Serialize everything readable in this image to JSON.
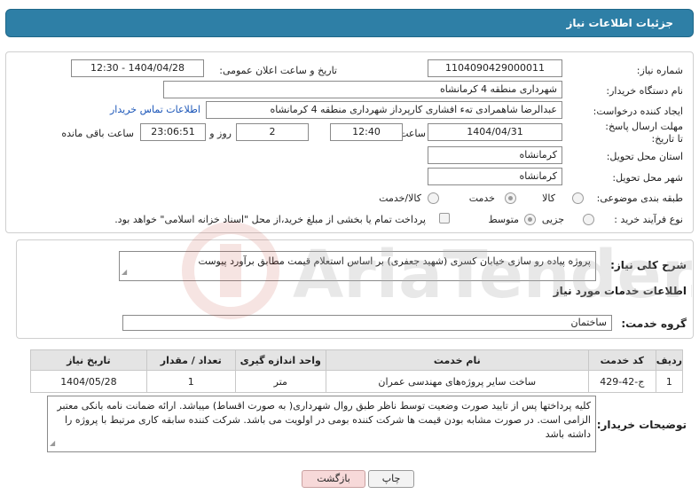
{
  "header": {
    "title": "جزئیات اطلاعات نیاز"
  },
  "form": {
    "need_number": {
      "label": "شماره نیاز:",
      "value": "1104090429000011"
    },
    "announce_datetime": {
      "label": "تاریخ و ساعت اعلان عمومی:",
      "value": "1404/04/28 - 12:30"
    },
    "buyer_org": {
      "label": "نام دستگاه خریدار:",
      "value": "شهرداری منطقه 4 کرمانشاه"
    },
    "creator": {
      "label": "ایجاد کننده درخواست:",
      "value": "عبدالرضا شاهمرادی تهء افشاری کارپرداز شهرداری منطقه 4 کرمانشاه",
      "contact_link": "اطلاعات تماس خریدار"
    },
    "deadline": {
      "label": "مهلت ارسال پاسخ: تا تاریخ:",
      "date": "1404/04/31",
      "time_label": "ساعت",
      "time": "12:40",
      "days": "2",
      "days_label": "روز و",
      "remaining": "23:06:51",
      "remaining_label": "ساعت باقی مانده"
    },
    "delivery_province": {
      "label": "استان محل تحویل:",
      "value": "کرمانشاه"
    },
    "delivery_city": {
      "label": "شهر محل تحویل:",
      "value": "کرمانشاه"
    },
    "category": {
      "label": "طبقه بندی موضوعی:",
      "options": [
        "کالا",
        "خدمت",
        "کالا/خدمت"
      ],
      "selected": "خدمت"
    },
    "purchase_type": {
      "label": "نوع فرآیند خرید :",
      "options": [
        "جزیی",
        "متوسط"
      ],
      "selected": "متوسط",
      "treasury_note": "پرداخت تمام یا بخشی از مبلغ خرید،از محل \"اسناد خزانه اسلامی\" خواهد بود."
    }
  },
  "summary": {
    "label": "شرح کلی نیاز:",
    "text": "پروژه پیاده رو سازی خیابان کسری (شهید جعفری) بر اساس استعلام قیمت مطابق برآورد پیوست"
  },
  "services": {
    "section_title": "اطلاعات خدمات مورد نیاز",
    "group_label": "گروه خدمت:",
    "group_value": "ساختمان",
    "columns": [
      "ردیف",
      "کد خدمت",
      "نام خدمت",
      "واحد اندازه گیری",
      "تعداد / مقدار",
      "تاریخ نیاز"
    ],
    "rows": [
      {
        "index": "1",
        "code": "ج-42-429",
        "name": "ساخت سایر پروژه‌های مهندسی عمران",
        "unit": "متر",
        "qty": "1",
        "date": "1404/05/28"
      }
    ]
  },
  "buyer_notes": {
    "label": "توضیحات خریدار:",
    "text": "کلیه پرداختها پس از تایید صورت وضعیت توسط ناظر طبق روال شهرداری( به صورت اقساط) میباشد. ارائه ضمانت نامه بانکی معتبر الزامی است. در صورت مشابه بودن قیمت ها شرکت کننده بومی در اولویت می باشد. شرکت کننده سابقه کاری مرتبط با پروژه را داشته باشد"
  },
  "buttons": {
    "print": "چاپ",
    "back": "بازگشت"
  },
  "watermark": {
    "text": "AriaTender.neT"
  },
  "colors": {
    "header": "#2e7fa6",
    "link": "#1a55b8",
    "back_button": "#f7d9d9"
  }
}
